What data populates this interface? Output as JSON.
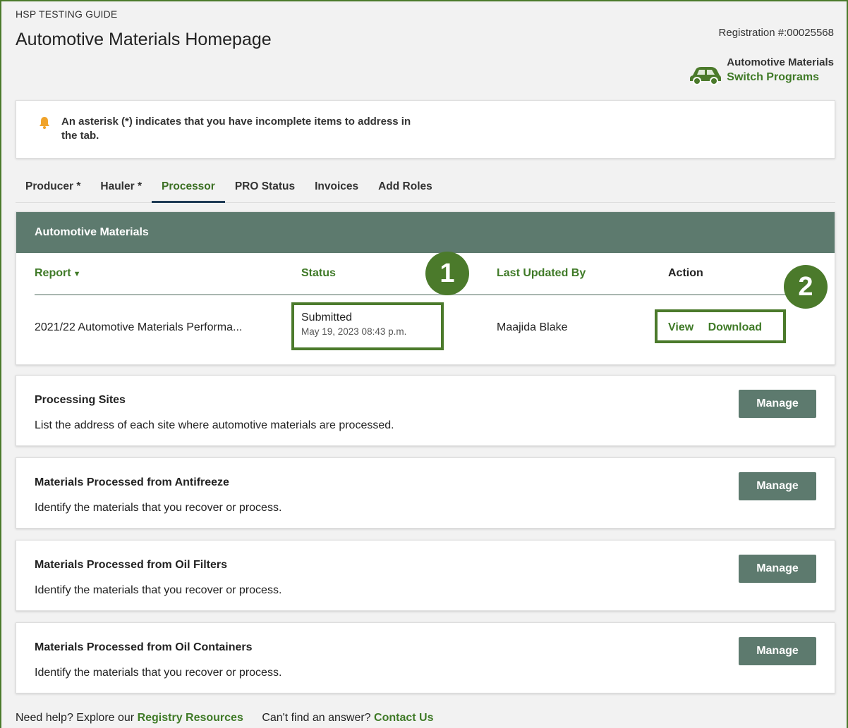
{
  "header": {
    "guide_label": "HSP TESTING GUIDE",
    "page_title": "Automotive Materials Homepage",
    "registration": "Registration #:00025568",
    "program_name": "Automotive Materials",
    "switch_programs": "Switch Programs"
  },
  "notice": {
    "icon": "bell-icon",
    "text": "An asterisk (*) indicates that you have incomplete items to address in the tab."
  },
  "tabs": [
    {
      "label": "Producer *"
    },
    {
      "label": "Hauler *"
    },
    {
      "label": "Processor",
      "active": true
    },
    {
      "label": "PRO Status"
    },
    {
      "label": "Invoices"
    },
    {
      "label": "Add Roles"
    }
  ],
  "report_card": {
    "title": "Automotive Materials",
    "columns": {
      "report": "Report",
      "status": "Status",
      "last_updated_by": "Last Updated By",
      "action": "Action"
    },
    "row": {
      "report": "2021/22 Automotive Materials Performa...",
      "status": "Submitted",
      "status_date": "May 19, 2023 08:43 p.m.",
      "updated_by": "Maajida Blake",
      "view": "View",
      "download": "Download"
    },
    "callouts": [
      "1",
      "2"
    ]
  },
  "sections": [
    {
      "title": "Processing Sites",
      "description": "List the address of each site where automotive materials are processed.",
      "button": "Manage"
    },
    {
      "title": "Materials Processed from Antifreeze",
      "description": "Identify the materials that you recover or process.",
      "button": "Manage"
    },
    {
      "title": "Materials Processed from Oil Filters",
      "description": "Identify the materials that you recover or process.",
      "button": "Manage"
    },
    {
      "title": "Materials Processed from Oil Containers",
      "description": "Identify the materials that you recover or process.",
      "button": "Manage"
    }
  ],
  "footer": {
    "help_text": "Need help? Explore our",
    "resources_link": "Registry Resources",
    "answer_text": "Can't find an answer?",
    "contact_link": "Contact Us"
  },
  "colors": {
    "accent_green": "#3f7a27",
    "header_bar": "#5d7a6e",
    "callout": "#4b7a2b",
    "tab_underline": "#1f3b56"
  }
}
